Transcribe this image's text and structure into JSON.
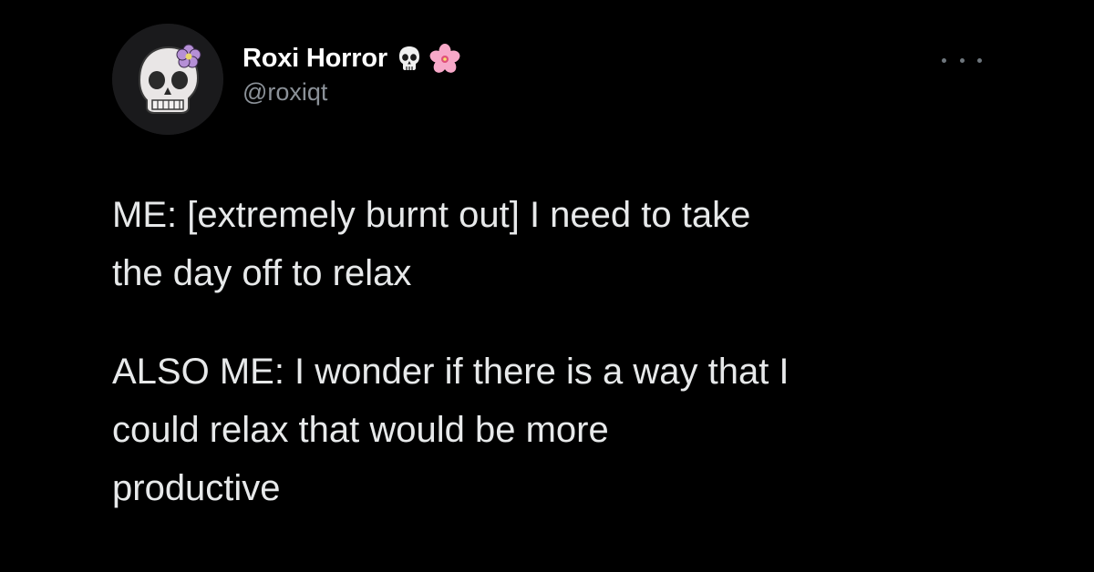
{
  "tweet": {
    "author": {
      "display_name": "Roxi Horror",
      "handle": "@roxiqt",
      "name_emojis": [
        "skull-icon",
        "cherry-blossom-icon"
      ],
      "avatar": "skull-with-flower-avatar"
    },
    "menu_icon": "more-options-icon",
    "paragraphs": [
      "ME: [extremely burnt out] I need to take\nthe day off to relax",
      "ALSO ME: I wonder if there is a way that I\ncould relax that would be more\nproductive"
    ]
  },
  "colors": {
    "background": "#000000",
    "text_primary": "#e7e9ea",
    "text_secondary": "#8b9198",
    "flower_pink": "#f7a8c8"
  }
}
